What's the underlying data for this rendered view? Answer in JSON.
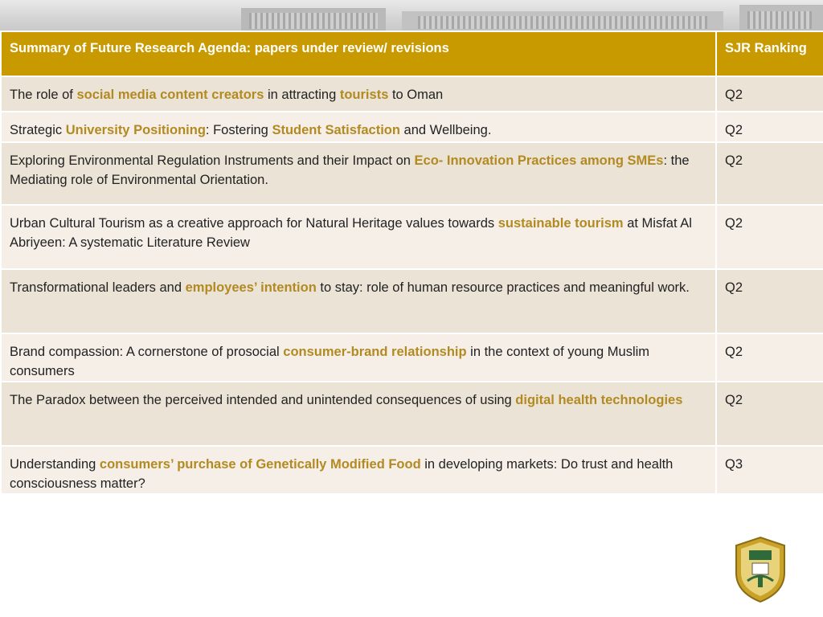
{
  "header": {
    "title": "Summary of Future Research Agenda: papers under review/ revisions",
    "ranking_label": "SJR Ranking"
  },
  "rows": [
    {
      "segments": [
        {
          "text": "The role of ",
          "hl": false
        },
        {
          "text": "social media content creators",
          "hl": true
        },
        {
          "text": " in attracting ",
          "hl": false
        },
        {
          "text": "tourists",
          "hl": true
        },
        {
          "text": " to Oman",
          "hl": false
        }
      ],
      "rank": "Q2"
    },
    {
      "segments": [
        {
          "text": "Strategic ",
          "hl": false
        },
        {
          "text": "University Positioning",
          "hl": true
        },
        {
          "text": ": Fostering ",
          "hl": false
        },
        {
          "text": "Student Satisfaction",
          "hl": true
        },
        {
          "text": " and Wellbeing.",
          "hl": false
        }
      ],
      "rank": "Q2"
    },
    {
      "segments": [
        {
          "text": "Exploring Environmental Regulation Instruments and their Impact on ",
          "hl": false
        },
        {
          "text": "Eco- Innovation Practices among SMEs",
          "hl": true
        },
        {
          "text": ": the Mediating role of Environmental Orientation.",
          "hl": false
        }
      ],
      "rank": "Q2"
    },
    {
      "segments": [
        {
          "text": "Urban Cultural Tourism as a creative approach for Natural Heritage values towards ",
          "hl": false
        },
        {
          "text": "sustainable tourism",
          "hl": true
        },
        {
          "text": " at Misfat Al Abriyeen: A systematic Literature Review",
          "hl": false
        }
      ],
      "rank": "Q2"
    },
    {
      "segments": [
        {
          "text": "Transformational leaders and ",
          "hl": false
        },
        {
          "text": "employees’ intention",
          "hl": true
        },
        {
          "text": " to stay: role of human resource practices and meaningful work.",
          "hl": false
        }
      ],
      "rank": "Q2"
    },
    {
      "segments": [
        {
          "text": "Brand compassion: A cornerstone of prosocial ",
          "hl": false
        },
        {
          "text": "consumer-brand relationship",
          "hl": true
        },
        {
          "text": " in the context of young Muslim consumers",
          "hl": false
        }
      ],
      "rank": "Q2"
    },
    {
      "segments": [
        {
          "text": "The Paradox between the perceived intended and unintended consequences of using ",
          "hl": false
        },
        {
          "text": "digital health technologies",
          "hl": true
        }
      ],
      "rank": "Q2"
    },
    {
      "segments": [
        {
          "text": "Understanding ",
          "hl": false
        },
        {
          "text": "consumers’ purchase of Genetically Modified Food",
          "hl": true
        },
        {
          "text": " in developing markets: Do trust and health consciousness matter?",
          "hl": false
        }
      ],
      "rank": "Q3"
    }
  ],
  "colors": {
    "header_bg": "#c99a00",
    "highlight": "#b38a22",
    "row_odd": "#ebe3d6",
    "row_even": "#f5efe8"
  },
  "icons": {
    "banner": "building-photo",
    "logo": "university-emblem-icon"
  }
}
